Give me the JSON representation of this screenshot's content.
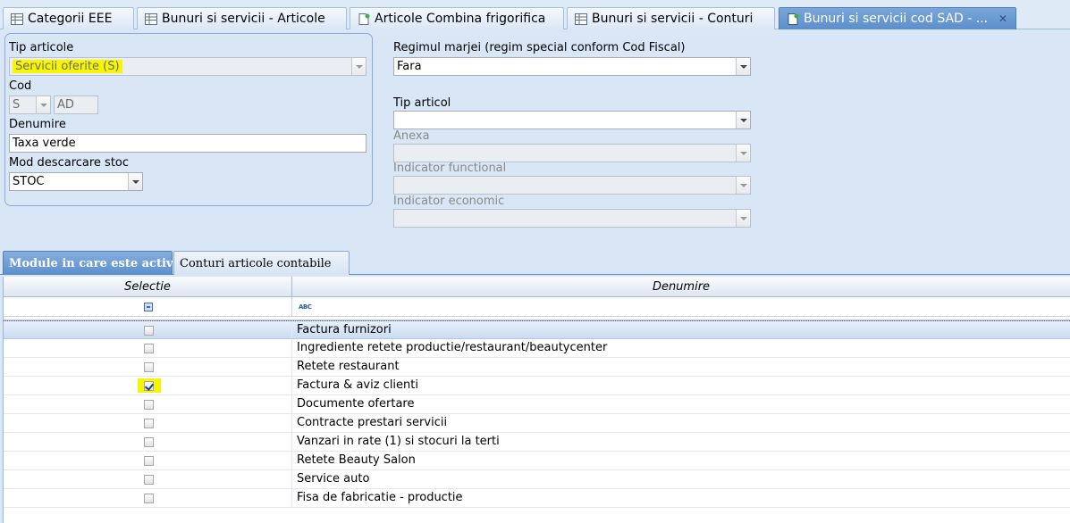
{
  "doc_tabs": [
    {
      "label": "Categorii EEE",
      "icon": "grid-table-icon"
    },
    {
      "label": "Bunuri si servicii - Articole",
      "icon": "grid-table-icon"
    },
    {
      "label": "Articole Combina frigorifica",
      "icon": "document-edit-icon"
    },
    {
      "label": "Bunuri si servicii - Conturi",
      "icon": "grid-table-icon"
    },
    {
      "label": "Bunuri si servicii cod SAD - ...",
      "icon": "document-edit-icon",
      "active": true
    }
  ],
  "form": {
    "tip_articole": {
      "label": "Tip articole",
      "value": "Servicii oferite (S)"
    },
    "cod": {
      "label": "Cod",
      "prefix": "S",
      "suffix": "AD"
    },
    "denumire": {
      "label": "Denumire",
      "value": "Taxa verde"
    },
    "mod_descarcare": {
      "label": "Mod descarcare stoc",
      "value": "STOC"
    },
    "regimul_marjei": {
      "label": "Regimul marjei (regim special conform Cod Fiscal)",
      "value": "Fara"
    },
    "tip_articol": {
      "label": "Tip articol",
      "value": ""
    },
    "anexa": {
      "label": "Anexa",
      "value": ""
    },
    "indicator_functional": {
      "label": "Indicator functional",
      "value": ""
    },
    "indicator_economic": {
      "label": "Indicator economic",
      "value": ""
    }
  },
  "grid_tabs": [
    {
      "label": "Module in care este activ",
      "active": true
    },
    {
      "label": "Conturi articole contabile",
      "active": false
    }
  ],
  "grid": {
    "columns": [
      "Selectie",
      "Denumire"
    ],
    "filter_abc": "ABC",
    "rows": [
      {
        "name": "Factura furnizori",
        "checked": false,
        "selected": true
      },
      {
        "name": "Ingrediente retete productie/restaurant/beautycenter",
        "checked": false
      },
      {
        "name": "Retete restaurant",
        "checked": false
      },
      {
        "name": "Factura & aviz clienti",
        "checked": true,
        "highlight": true
      },
      {
        "name": "Documente ofertare",
        "checked": false
      },
      {
        "name": "Contracte prestari servicii",
        "checked": false
      },
      {
        "name": "Vanzari in rate (1) si stocuri la terti",
        "checked": false
      },
      {
        "name": "Retete Beauty Salon",
        "checked": false
      },
      {
        "name": "Service auto",
        "checked": false
      },
      {
        "name": "Fisa de fabricatie - productie",
        "checked": false
      }
    ]
  },
  "colors": {
    "highlight": "#f6f600",
    "active_tab": "#5c8fcd",
    "background": "#d8e6f5"
  }
}
